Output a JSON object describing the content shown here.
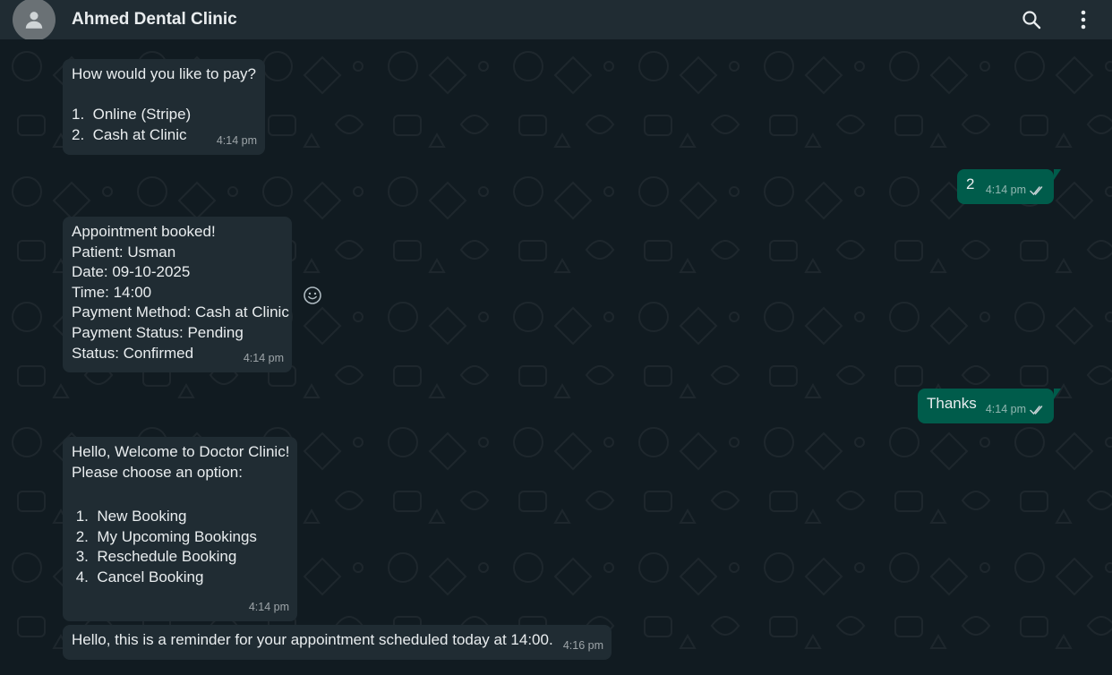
{
  "header": {
    "title": "Ahmed Dental Clinic",
    "avatar_icon": "person-icon",
    "search_icon": "search-icon",
    "menu_icon": "more-vertical-icon"
  },
  "colors": {
    "header_bg": "#202c33",
    "chat_bg": "#111b21",
    "incoming_bubble": "#202c33",
    "outgoing_bubble": "#005c4b",
    "text": "#e9edef",
    "meta": "#8696a0"
  },
  "messages": [
    {
      "id": "m1",
      "direction": "incoming",
      "lines": [
        "How would you like to pay?",
        "",
        "1.  Online (Stripe)",
        "2.  Cash at Clinic"
      ],
      "time": "4:14 pm"
    },
    {
      "id": "m2",
      "direction": "outgoing",
      "lines": [
        "2"
      ],
      "time": "4:14 pm",
      "status_icon": "double-check-icon"
    },
    {
      "id": "m3",
      "direction": "incoming",
      "lines": [
        "Appointment booked!",
        "Patient: Usman",
        "Date: 09-10-2025",
        "Time: 14:00",
        "Payment Method: Cash at Clinic",
        "Payment Status: Pending",
        "Status: Confirmed"
      ],
      "time": "4:14 pm",
      "reaction_icon": "emoji-react-icon"
    },
    {
      "id": "m4",
      "direction": "outgoing",
      "lines": [
        "Thanks"
      ],
      "time": "4:14 pm",
      "status_icon": "double-check-icon"
    },
    {
      "id": "m5",
      "direction": "incoming",
      "lines": [
        "Hello, Welcome to Doctor Clinic!",
        "Please choose an option:",
        "",
        " 1.  New Booking",
        " 2.  My Upcoming Bookings",
        " 3.  Reschedule Booking",
        " 4.  Cancel Booking"
      ],
      "time": "4:14 pm"
    },
    {
      "id": "m6",
      "direction": "incoming",
      "lines": [
        "Hello, this is a reminder for your appointment scheduled today at 14:00."
      ],
      "time": "4:16 pm"
    }
  ]
}
